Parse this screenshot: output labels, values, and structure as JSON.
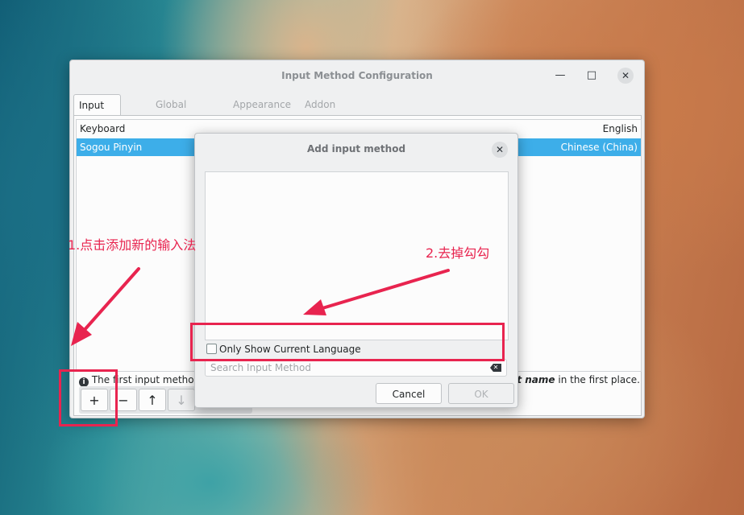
{
  "window": {
    "title": "Input Method Configuration",
    "controls": {
      "minimize": "—",
      "maximize": "□",
      "close": "✕"
    },
    "tabs": [
      "Input Method",
      "Global Config",
      "Appearance",
      "Addon"
    ],
    "active_tab": "Input Method",
    "input_methods": [
      {
        "name": "Keyboard",
        "language": "English",
        "selected": false
      },
      {
        "name": "Sogou Pinyin",
        "language": "Chinese (China)",
        "selected": true
      }
    ],
    "info": {
      "icon": "info-icon",
      "text_left": "The first input method w",
      "text_right_em": "out name",
      "text_right": " in the first place."
    },
    "toolbar": {
      "add": "+",
      "remove": "−",
      "move_up": "↑",
      "move_down": "↓"
    }
  },
  "dialog": {
    "title": "Add input method",
    "close": "✕",
    "checkbox_label": "Only Show Current Language",
    "checkbox_checked": false,
    "search_placeholder": "Search Input Method",
    "search_value": "",
    "cancel_label": "Cancel",
    "ok_label": "OK"
  },
  "annotations": {
    "step1": "1.点击添加新的输入法",
    "step2": "2.去掉勾勾",
    "color": "#e8244f"
  }
}
